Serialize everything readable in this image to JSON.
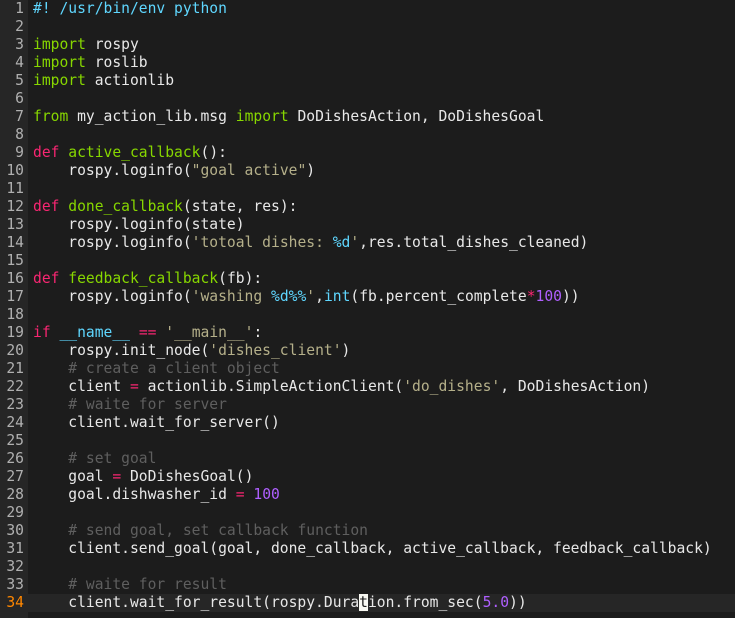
{
  "editor": {
    "current_line": 34,
    "lines": [
      [
        [
          "#! /usr/bin/env python",
          "shebang"
        ]
      ],
      [],
      [
        [
          "import",
          "kw"
        ],
        [
          " rospy",
          ""
        ]
      ],
      [
        [
          "import",
          "kw"
        ],
        [
          " roslib",
          ""
        ]
      ],
      [
        [
          "import",
          "kw"
        ],
        [
          " actionlib",
          ""
        ]
      ],
      [],
      [
        [
          "from",
          "kw"
        ],
        [
          " my_action_lib.msg ",
          ""
        ],
        [
          "import",
          "kw"
        ],
        [
          " DoDishesAction, DoDishesGoal",
          ""
        ]
      ],
      [],
      [
        [
          "def",
          "def"
        ],
        [
          " ",
          ""
        ],
        [
          "active_callback",
          "fn"
        ],
        [
          "():",
          ""
        ]
      ],
      [
        [
          "    rospy.loginfo(",
          ""
        ],
        [
          "\"goal active\"",
          "str"
        ],
        [
          ")",
          ""
        ]
      ],
      [],
      [
        [
          "def",
          "def"
        ],
        [
          " ",
          ""
        ],
        [
          "done_callback",
          "fn"
        ],
        [
          "(state, res):",
          ""
        ]
      ],
      [
        [
          "    rospy.loginfo(state)",
          ""
        ]
      ],
      [
        [
          "    rospy.loginfo(",
          ""
        ],
        [
          "'totoal dishes: ",
          "str"
        ],
        [
          "%d",
          "fmt"
        ],
        [
          "'",
          "str"
        ],
        [
          ",res.total_dishes_cleaned)",
          ""
        ]
      ],
      [],
      [
        [
          "def",
          "def"
        ],
        [
          " ",
          ""
        ],
        [
          "feedback_callback",
          "fn"
        ],
        [
          "(fb):",
          ""
        ]
      ],
      [
        [
          "    rospy.loginfo(",
          ""
        ],
        [
          "'washing ",
          "str"
        ],
        [
          "%d%%",
          "fmt"
        ],
        [
          "'",
          "str"
        ],
        [
          ",",
          ""
        ],
        [
          "int",
          "builtin"
        ],
        [
          "(fb.percent_complete",
          ""
        ],
        [
          "*",
          "op"
        ],
        [
          "100",
          "num"
        ],
        [
          "))",
          ""
        ]
      ],
      [],
      [
        [
          "if",
          "def"
        ],
        [
          " ",
          ""
        ],
        [
          "__name__",
          "builtin"
        ],
        [
          " ",
          ""
        ],
        [
          "==",
          "op"
        ],
        [
          " ",
          ""
        ],
        [
          "'__main__'",
          "str"
        ],
        [
          ":",
          ""
        ]
      ],
      [
        [
          "    rospy.init_node(",
          ""
        ],
        [
          "'dishes_client'",
          "str"
        ],
        [
          ")",
          ""
        ]
      ],
      [
        [
          "    ",
          ""
        ],
        [
          "# create a client object",
          "com"
        ]
      ],
      [
        [
          "    client ",
          ""
        ],
        [
          "=",
          "op"
        ],
        [
          " actionlib.SimpleActionClient(",
          ""
        ],
        [
          "'do_dishes'",
          "str"
        ],
        [
          ", DoDishesAction)",
          ""
        ]
      ],
      [
        [
          "    ",
          ""
        ],
        [
          "# waite for server",
          "com"
        ]
      ],
      [
        [
          "    client.wait_for_server()",
          ""
        ]
      ],
      [],
      [
        [
          "    ",
          ""
        ],
        [
          "# set goal",
          "com"
        ]
      ],
      [
        [
          "    goal ",
          ""
        ],
        [
          "=",
          "op"
        ],
        [
          " DoDishesGoal()",
          ""
        ]
      ],
      [
        [
          "    goal.dishwasher_id ",
          ""
        ],
        [
          "=",
          "op"
        ],
        [
          " ",
          ""
        ],
        [
          "100",
          "num"
        ]
      ],
      [],
      [
        [
          "    ",
          ""
        ],
        [
          "# send goal, set callback function",
          "com"
        ]
      ],
      [
        [
          "    client.send_goal(goal, done_callback, active_callback, feedback_callback)",
          ""
        ]
      ],
      [],
      [
        [
          "    ",
          ""
        ],
        [
          "# waite for result",
          "com"
        ]
      ],
      [
        [
          "    client.wait_for_result(rospy.Dura",
          ""
        ],
        [
          "t",
          "cursor"
        ],
        [
          "ion.from_sec(",
          ""
        ],
        [
          "5.0",
          "num"
        ],
        [
          "))",
          ""
        ]
      ]
    ]
  }
}
